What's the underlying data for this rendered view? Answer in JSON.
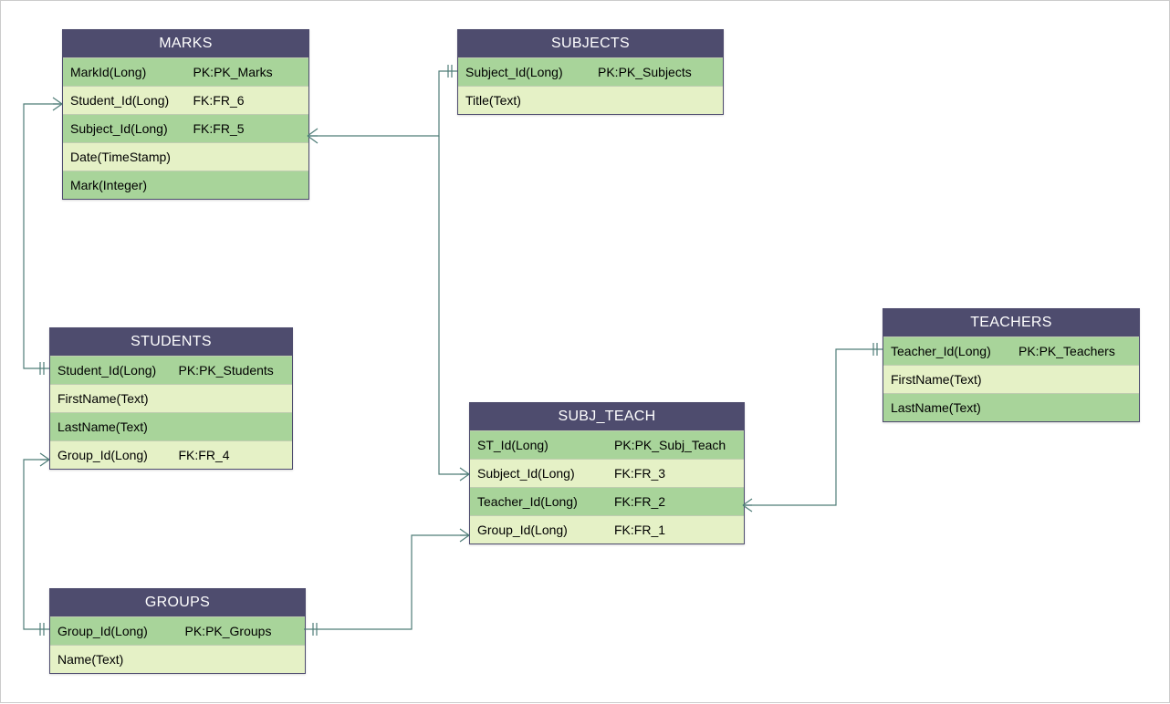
{
  "entities": {
    "marks": {
      "title": "MARKS",
      "rows": [
        {
          "left": "MarkId(Long)",
          "right": "PK:PK_Marks"
        },
        {
          "left": "Student_Id(Long)",
          "right": "FK:FR_6"
        },
        {
          "left": "Subject_Id(Long)",
          "right": "FK:FR_5"
        },
        {
          "left": "Date(TimeStamp)",
          "right": ""
        },
        {
          "left": "Mark(Integer)",
          "right": ""
        }
      ]
    },
    "subjects": {
      "title": "SUBJECTS",
      "rows": [
        {
          "left": "Subject_Id(Long)",
          "right": "PK:PK_Subjects"
        },
        {
          "left": "Title(Text)",
          "right": ""
        }
      ]
    },
    "students": {
      "title": "STUDENTS",
      "rows": [
        {
          "left": "Student_Id(Long)",
          "right": "PK:PK_Students"
        },
        {
          "left": "FirstName(Text)",
          "right": ""
        },
        {
          "left": "LastName(Text)",
          "right": ""
        },
        {
          "left": "Group_Id(Long)",
          "right": "FK:FR_4"
        }
      ]
    },
    "subj_teach": {
      "title": "SUBJ_TEACH",
      "rows": [
        {
          "left": "ST_Id(Long)",
          "right": "PK:PK_Subj_Teach"
        },
        {
          "left": "Subject_Id(Long)",
          "right": "FK:FR_3"
        },
        {
          "left": "Teacher_Id(Long)",
          "right": "FK:FR_2"
        },
        {
          "left": "Group_Id(Long)",
          "right": "FK:FR_1"
        }
      ]
    },
    "teachers": {
      "title": "TEACHERS",
      "rows": [
        {
          "left": "Teacher_Id(Long)",
          "right": "PK:PK_Teachers"
        },
        {
          "left": "FirstName(Text)",
          "right": ""
        },
        {
          "left": "LastName(Text)",
          "right": ""
        }
      ]
    },
    "groups": {
      "title": "GROUPS",
      "rows": [
        {
          "left": "Group_Id(Long)",
          "right": "PK:PK_Groups"
        },
        {
          "left": "Name(Text)",
          "right": ""
        }
      ]
    }
  },
  "colors": {
    "header": "#4e4c6e",
    "rowDark": "#a8d49a",
    "rowLight": "#e5f1c6",
    "connector": "#4f7d78"
  }
}
